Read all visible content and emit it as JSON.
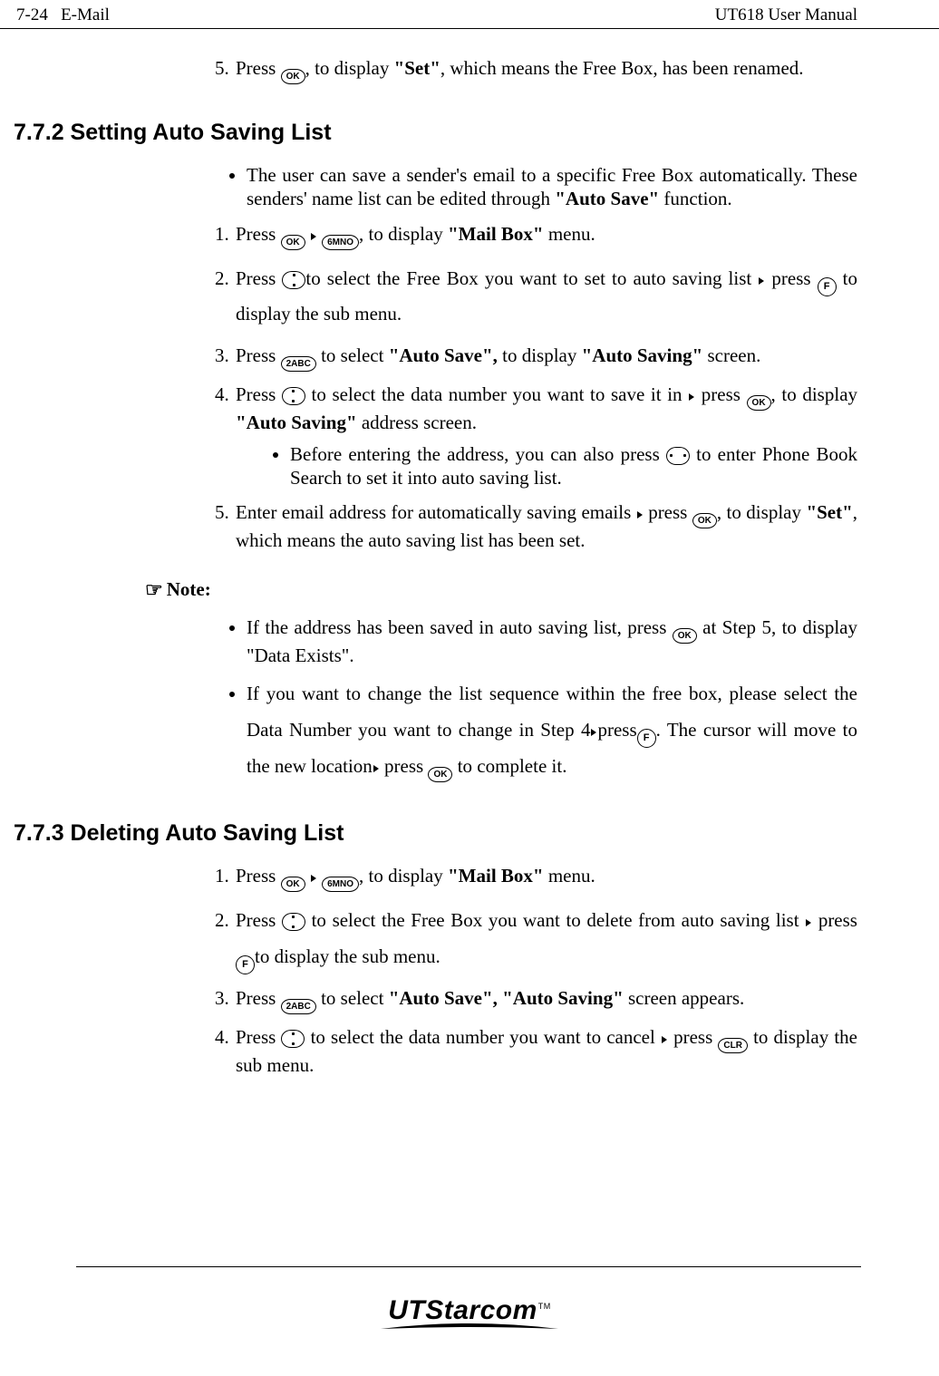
{
  "header": {
    "page_ref": "7-24",
    "section": "E-Mail",
    "doc_title": "UT618 User Manual"
  },
  "step5_top": {
    "pre": "Press ",
    "post1": ", to display ",
    "set": "\"Set\"",
    "post2": ", which means the Free Box, has been renamed."
  },
  "sec772": {
    "heading": "7.7.2 Setting Auto Saving List",
    "bullet1a": "The user can save a sender's email to a specific Free Box automatically. These senders' name list can be edited through ",
    "bullet1b": "\"Auto Save\"",
    "bullet1c": " function.",
    "s1": {
      "a": "Press ",
      "b": ", to display ",
      "c": "\"Mail Box\"",
      "d": " menu."
    },
    "s2": {
      "a": "Press ",
      "b": "to select the Free Box you want to set to auto saving list ",
      "c": " press ",
      "d": " to display the sub menu."
    },
    "s3": {
      "a": "Press ",
      "b": " to select ",
      "c": "\"Auto Save\",",
      "d": " to display ",
      "e": "\"Auto Saving\"",
      "f": " screen."
    },
    "s4": {
      "a": "Press ",
      "b": " to select the data number you want to save it in ",
      "c": " press ",
      "d": ", to display ",
      "e": "\"Auto Saving\"",
      "f": " address screen."
    },
    "s4sub": {
      "a": "Before entering the address, you can also press ",
      "b": " to enter Phone Book Search to set it into auto saving list."
    },
    "s5": {
      "a": "Enter email address for automatically saving emails ",
      "b": " press ",
      "c": ", to display ",
      "d": "\"Set\"",
      "e": ", which means the auto saving list has been set."
    },
    "note_label": "Note:",
    "note1": {
      "a": "If the address has been saved in auto saving list, press ",
      "b": " at Step 5, to display \"Data Exists\"."
    },
    "note2": {
      "a": "If you want to change the list sequence within the free box, please select the Data Number you want to change in Step 4",
      "b": "press",
      "c": ". The cursor will move to the new location",
      "d": " press ",
      "e": " to complete it."
    }
  },
  "sec773": {
    "heading": "7.7.3 Deleting Auto Saving List",
    "s1": {
      "a": "Press ",
      "b": ", to display ",
      "c": "\"Mail Box\"",
      "d": " menu."
    },
    "s2": {
      "a": "Press ",
      "b": " to select the Free Box you want to delete from auto saving list ",
      "c": " press ",
      "d": "to display the sub menu."
    },
    "s3": {
      "a": "Press ",
      "b": " to select ",
      "c": "\"Auto Save\", \"Auto Saving\"",
      "d": " screen appears."
    },
    "s4": {
      "a": "Press ",
      "b": " to select the data number you want to cancel ",
      "c": " press ",
      "d": " to display the sub menu."
    }
  },
  "keys": {
    "ok": "OK",
    "six": "6MNO",
    "two": "2ABC",
    "f": "F",
    "clr": "CLR"
  },
  "logo": {
    "brand": "UTStarcom",
    "tm": "TM"
  }
}
